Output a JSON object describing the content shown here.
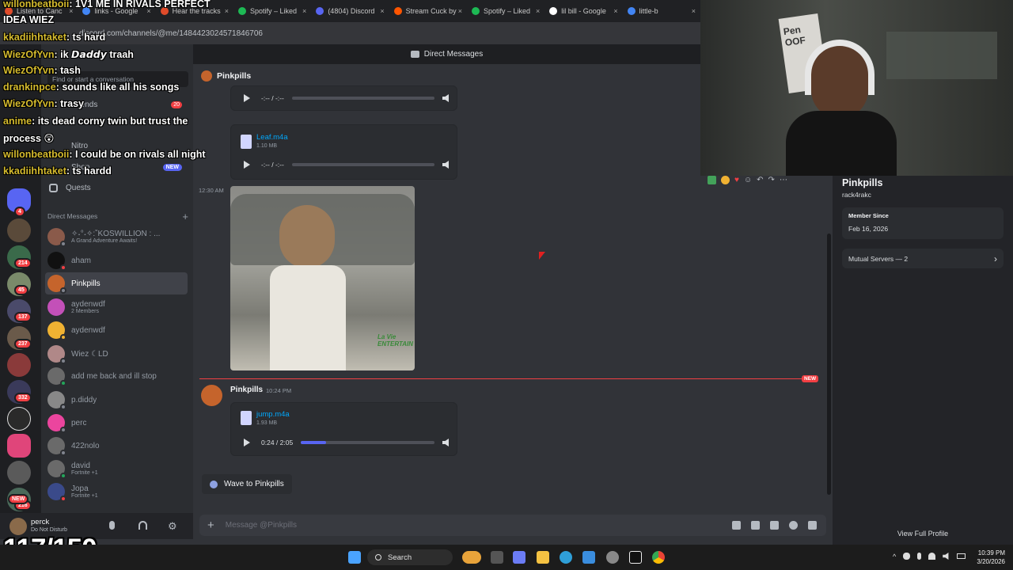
{
  "browser": {
    "tabs": [
      {
        "label": "Listen to Canc",
        "color": "#e04b2a"
      },
      {
        "label": "links - Google",
        "color": "#4285f4"
      },
      {
        "label": "Hear the tracks",
        "color": "#e04b2a"
      },
      {
        "label": "Spotify – Liked",
        "color": "#1db954"
      },
      {
        "label": "(4804) Discord",
        "color": "#5865f2"
      },
      {
        "label": "Stream Cuck by",
        "color": "#ff5500"
      },
      {
        "label": "Spotify – Liked",
        "color": "#1db954"
      },
      {
        "label": "lil bill - Google",
        "color": "#ffffff"
      },
      {
        "label": "little-b",
        "color": "#4285f4"
      }
    ],
    "url": "discord.com/channels/@me/1484423024571846706"
  },
  "discord": {
    "top_title": "Direct Messages",
    "sidebar": {
      "search_placeholder": "Find or start a conversation",
      "nav": {
        "friends": "Friends",
        "nitro": "Nitro",
        "shop": "Shop",
        "shop_badge": "NEW",
        "quests": "Quests",
        "requests_badge": "20"
      },
      "dm_header": "Direct Messages",
      "dms": [
        {
          "name": "✧˖°˖✧:˚KOSWILLION : ...",
          "sub": "A Grand Adventure Awaits!",
          "color": "#8a5a4a"
        },
        {
          "name": "aham",
          "sub": "",
          "color": "#111111"
        },
        {
          "name": "Pinkpills",
          "sub": "",
          "color": "#c5642c"
        },
        {
          "name": "aydenwdf",
          "sub": "2 Members",
          "color": "#c350b8"
        },
        {
          "name": "aydenwdf",
          "sub": "",
          "color": "#f0b232"
        },
        {
          "name": "Wiez  ☾LD",
          "sub": "",
          "color": "#b08888"
        },
        {
          "name": "add me back and ill stop",
          "sub": "",
          "color": "#6a6a6a"
        },
        {
          "name": "p.diddy",
          "sub": "",
          "color": "#888888"
        },
        {
          "name": "perc",
          "sub": "",
          "color": "#eb459e"
        },
        {
          "name": "422nolo",
          "sub": "",
          "color": "#6a6a6a"
        },
        {
          "name": "david",
          "sub": "Fortnite +1",
          "color": "#6a6a6a"
        },
        {
          "name": "Jopa",
          "sub": "Fortnite +1",
          "color": "#3a4a8a"
        }
      ]
    },
    "user": {
      "name": "perck",
      "status": "Do Not Disturb"
    },
    "chat": {
      "partner": "Pinkpills",
      "audio1": {
        "time": "-:-- / -:--"
      },
      "file2": {
        "name": "Leaf.m4a",
        "size": "1.10 MB",
        "time": "-:-- / -:--"
      },
      "image_time": "12:30 AM",
      "image_watermark": "La Vie ENTERTAIN",
      "new_label": "NEW",
      "message": {
        "author": "Pinkpills",
        "time": "10:24 PM"
      },
      "file3": {
        "name": "jump.m4a",
        "size": "1.93 MB",
        "time": "0:24 / 2:05",
        "progress": 0.19
      },
      "wave_label": "Wave to Pinkpills",
      "composer_placeholder": "Message @Pinkpills"
    },
    "profile": {
      "name": "Pinkpills",
      "handle": "rack4rakc",
      "member_since_label": "Member Since",
      "member_since": "Feb 16, 2026",
      "mutual_servers": "Mutual Servers — 2",
      "view_full": "View Full Profile"
    }
  },
  "overlay": {
    "title": "1V1 ME IN RIVALS PERFECT",
    "title_user": "willonbeatboii",
    "idea": "IDEA WIEZ",
    "counter": "117/150",
    "messages": [
      {
        "user": "kkadiihhtaket",
        "text": "ts hard"
      },
      {
        "user": "WiezOfYvn",
        "text": "ik 𝘿𝙖𝙙𝙙𝙮 traah"
      },
      {
        "user": "WiezOfYvn",
        "text": "tash"
      },
      {
        "user": "drankinpce",
        "text": "sounds like all his songs"
      },
      {
        "user": "WiezOfYvn",
        "text": "trasy"
      },
      {
        "user": "anime",
        "text": "its dead corny twin but trust the"
      },
      {
        "user": "",
        "text": "process 😲"
      },
      {
        "user": "willonbeatboii",
        "text": "I could be on rivals all night"
      },
      {
        "user": "kkadiihhtaket",
        "text": "ts hardd"
      }
    ]
  },
  "taskbar": {
    "search": "Search",
    "time": "10:39 PM",
    "date": "3/20/2026"
  },
  "webcam": {
    "poster_text": "Pen OOF"
  }
}
